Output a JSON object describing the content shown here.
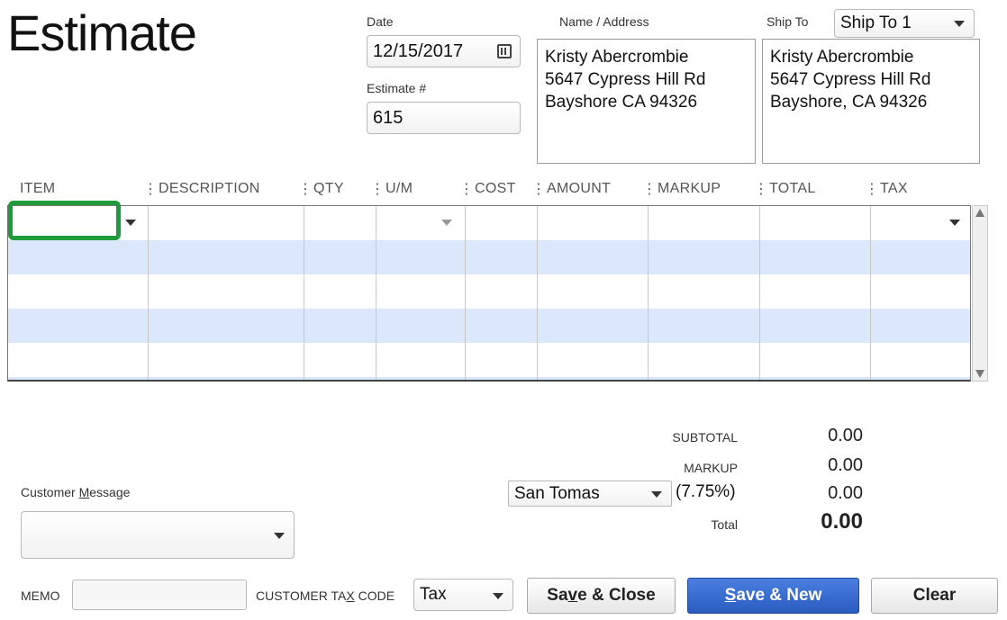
{
  "form": {
    "title": "Estimate"
  },
  "date": {
    "label": "Date",
    "value": "12/15/2017"
  },
  "estimate_no": {
    "label": "Estimate #",
    "value": "615"
  },
  "name_address": {
    "label": "Name / Address",
    "lines": [
      "Kristy Abercrombie",
      "5647 Cypress Hill Rd",
      "Bayshore CA 94326"
    ]
  },
  "ship_to": {
    "label": "Ship To",
    "selected": "Ship To 1",
    "lines": [
      "Kristy Abercrombie",
      "5647 Cypress Hill Rd",
      "Bayshore, CA 94326"
    ]
  },
  "columns": [
    "ITEM",
    "DESCRIPTION",
    "QTY",
    "U/M",
    "COST",
    "AMOUNT",
    "MARKUP",
    "TOTAL",
    "TAX"
  ],
  "totals": {
    "subtotal_label": "SUBTOTAL",
    "subtotal": "0.00",
    "markup_label": "MARKUP",
    "markup": "0.00",
    "tax_item": "San Tomas",
    "tax_rate": "(7.75%)",
    "tax": "0.00",
    "total_label": "Total",
    "total": "0.00"
  },
  "customer_message": {
    "label_pre": "Customer ",
    "label_u": "M",
    "label_post": "essage"
  },
  "memo": {
    "label": "MEMO",
    "value": ""
  },
  "tax_code": {
    "label_pre": "CUSTOMER TA",
    "label_u": "X",
    "label_post": " CODE",
    "value": "Tax"
  },
  "buttons": {
    "save_close_pre": "Sa",
    "save_close_u": "v",
    "save_close_post": "e & Close",
    "save_new_u": "S",
    "save_new_post": "ave & New",
    "clear": "Clear"
  },
  "colors": {
    "highlight": "#1e9b3a",
    "row_stripe": "#dbe8fb",
    "primary": "#2f64c8"
  }
}
